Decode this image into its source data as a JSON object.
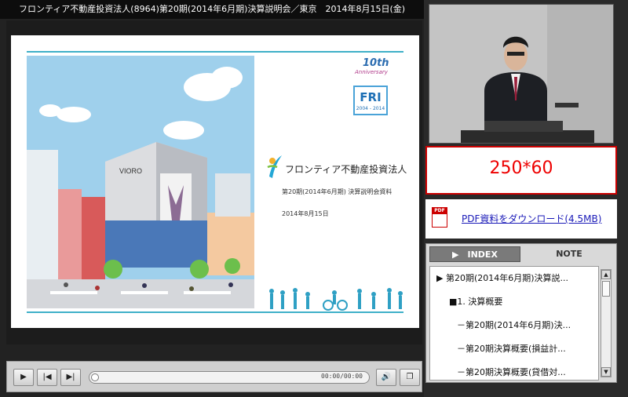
{
  "header": {
    "title": "フロンティア不動産投資法人(8964)第20期(2014年6月期)決算説明会／東京　2014年8月15日(金)"
  },
  "slide": {
    "anniversary_number": "10th",
    "anniversary_word": "Anniversary",
    "anniversary_logo": "FRI",
    "anniversary_years": "2004 - 2014",
    "store_sign": "VIORO",
    "company_name": "フロンティア不動産投資法人",
    "subtitle": "第20期(2014年6月期) 決算説明会資料",
    "date": "2014年8月15日"
  },
  "player": {
    "play_icon": "play-icon",
    "prev_icon": "skip-back-icon",
    "next_icon": "skip-forward-icon",
    "time": "00:00/00:00",
    "volume_icon": "volume-icon",
    "window_icon": "window-toggle-icon"
  },
  "ad": {
    "text": "250*60"
  },
  "pdf": {
    "link_text": "PDF資料をダウンロード(4.5MB)",
    "icon_label": "PDF"
  },
  "panel": {
    "tab_index": "▶　INDEX",
    "tab_note": "NOTE",
    "items": [
      {
        "text": "▶ 第20期(2014年6月期)決算説...",
        "level": 1
      },
      {
        "text": "■1. 決算概要",
        "level": 2
      },
      {
        "text": "－第20期(2014年6月期)決...",
        "level": 3
      },
      {
        "text": "－第20期決算概要(損益計...",
        "level": 3
      },
      {
        "text": "－第20期決算概要(貸借対...",
        "level": 3
      }
    ]
  },
  "colors": {
    "accent_teal": "#3fb0c8",
    "ad_red": "#e00000",
    "link_blue": "#1a1ab8"
  }
}
